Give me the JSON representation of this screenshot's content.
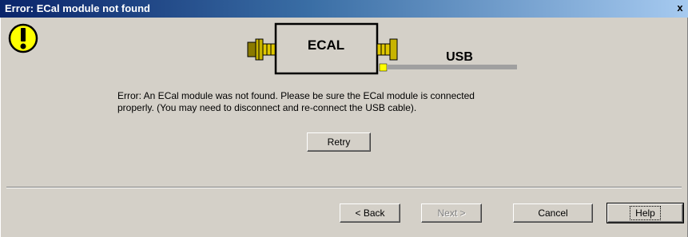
{
  "window": {
    "title": "Error:  ECal module not found",
    "close_glyph": "x"
  },
  "diagram": {
    "ecal_label": "ECAL",
    "usb_label": "USB"
  },
  "message": {
    "line1": "Error:  An ECal module was not found.  Please be sure the ECal module is connected",
    "line2": "properly.  (You may need to disconnect and re-connect the USB cable)."
  },
  "buttons": {
    "retry": "Retry",
    "back": "< Back",
    "next": "Next >",
    "cancel": "Cancel",
    "help": "Help"
  },
  "colors": {
    "titlebar_start": "#0a246a",
    "titlebar_end": "#a6caf0",
    "warning_fill": "#ffff00",
    "connector_gold": "#c8b400",
    "ecal_body": "#d4d0c8",
    "cable_gray": "#a0a0a0"
  },
  "icons": {
    "warning": "exclamation-warning-icon"
  }
}
